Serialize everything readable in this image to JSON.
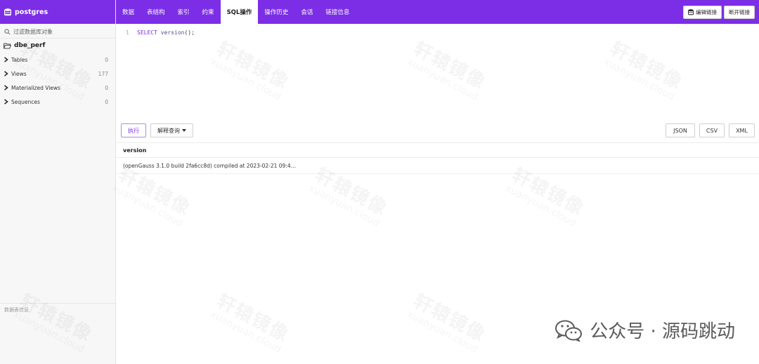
{
  "sidebar": {
    "db_name": "postgres",
    "filter_placeholder": "过滤数据库对象",
    "schema_name": "dbe_perf",
    "items": [
      {
        "label": "Tables",
        "count": "0"
      },
      {
        "label": "Views",
        "count": "177"
      },
      {
        "label": "Materialized Views",
        "count": "0"
      },
      {
        "label": "Sequences",
        "count": "0"
      }
    ],
    "footer_label": "数据表信息"
  },
  "nav": {
    "tabs": [
      "数据",
      "表结构",
      "索引",
      "约束",
      "SQL操作",
      "操作历史",
      "会话",
      "链接信息"
    ],
    "active_tab": "SQL操作",
    "edit_connection": "编辑链接",
    "disconnect": "断开链接"
  },
  "editor": {
    "line_number": "1",
    "kw": "SELECT",
    "fn": "version",
    "rest": "();"
  },
  "toolbar": {
    "execute": "执行",
    "explain": "解释查询",
    "json": "JSON",
    "csv": "CSV",
    "xml": "XML"
  },
  "results": {
    "column": "version",
    "value": "(openGauss 3.1.0 build 2fa6cc8d) compiled at 2023-02-21 09:4…"
  },
  "watermark": {
    "brand": "轩辕镜像",
    "domain": "xuanyuan.cloud"
  },
  "signature": {
    "text": "公众号 · 源码跳动"
  },
  "colors": {
    "accent": "#7c2ee6"
  }
}
